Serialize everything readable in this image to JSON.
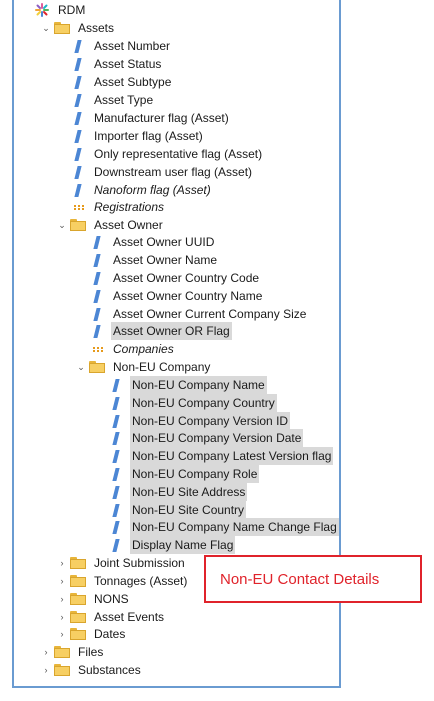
{
  "tree": {
    "root": "RDM",
    "assets": "Assets",
    "asset_number": "Asset Number",
    "asset_status": "Asset Status",
    "asset_subtype": "Asset Subtype",
    "asset_type": "Asset Type",
    "manufacturer_flag": "Manufacturer flag (Asset)",
    "importer_flag": "Importer flag (Asset)",
    "only_rep_flag": "Only representative flag (Asset)",
    "downstream_flag": "Downstream user flag (Asset)",
    "nanoform_flag": "Nanoform flag (Asset)",
    "registrations": "Registrations",
    "asset_owner": "Asset Owner",
    "owner_uuid": "Asset Owner UUID",
    "owner_name": "Asset Owner Name",
    "owner_country_code": "Asset Owner Country Code",
    "owner_country_name": "Asset Owner Country Name",
    "owner_company_size": "Asset Owner Current Company Size",
    "owner_or_flag": "Asset Owner OR Flag",
    "companies": "Companies",
    "non_eu_company": "Non-EU Company",
    "non_eu_name": "Non-EU Company Name",
    "non_eu_country": "Non-EU Company Country",
    "non_eu_version_id": "Non-EU Company Version ID",
    "non_eu_version_date": "Non-EU Company Version Date",
    "non_eu_latest_flag": "Non-EU Company Latest Version flag",
    "non_eu_role": "Non-EU Company Role",
    "non_eu_site_address": "Non-EU Site Address",
    "non_eu_site_country": "Non-EU Site Country",
    "non_eu_name_change": "Non-EU Company Name Change Flag",
    "display_name_flag": "Display Name Flag",
    "joint_submission": "Joint Submission",
    "tonnages": "Tonnages (Asset)",
    "nons": "NONS",
    "asset_events": "Asset Events",
    "dates": "Dates",
    "files": "Files",
    "substances": "Substances"
  },
  "callout": {
    "text": "Non-EU Contact Details",
    "color": "#e0232b"
  },
  "colors": {
    "folder": "#f7cf63",
    "attribute": "#4c86d4",
    "relationship": "#e69a1c",
    "selection": "#d9d9d9",
    "panel_border": "#6a9bd1"
  }
}
